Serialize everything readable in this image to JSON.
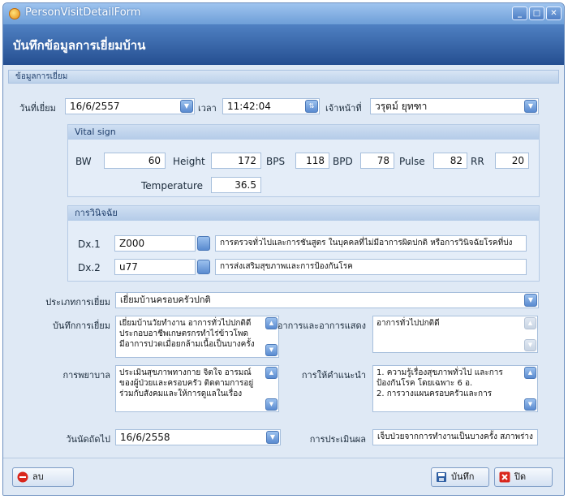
{
  "window": {
    "title": "PersonVisitDetailForm",
    "buttons": {
      "minimize": "_",
      "maximize": "□",
      "close": "✕"
    }
  },
  "header": {
    "title": "บันทึกข้อมูลการเยี่ยมบ้าน"
  },
  "section": {
    "title": "ข้อมูลการเยี่ยม"
  },
  "visit": {
    "date_label": "วันที่เยี่ยม",
    "date_value": "16/6/2557",
    "time_label": "เวลา",
    "time_value": "11:42:04",
    "officer_label": "เจ้าหน้าที่",
    "officer_value": "วรุตม์ ยุทฑา"
  },
  "vital": {
    "title": "Vital sign",
    "bw_label": "BW",
    "bw": "60",
    "height_label": "Height",
    "height": "172",
    "bps_label": "BPS",
    "bps": "118",
    "bpd_label": "BPD",
    "bpd": "78",
    "pulse_label": "Pulse",
    "pulse": "82",
    "rr_label": "RR",
    "rr": "20",
    "temp_label": "Temperature",
    "temp": "36.5"
  },
  "diagnosis": {
    "title": "การวินิจฉัย",
    "dx1_label": "Dx.1",
    "dx1_code": "Z000",
    "dx1_desc": "การตรวจทั่วไปและการชันสูตร ในบุคคลที่ไม่มีอาการผิดปกติ หรือการวินิจฉัยโรคที่บ่ง",
    "dx2_label": "Dx.2",
    "dx2_code": "u77",
    "dx2_desc": "การส่งเสริมสุขภาพและการป้องกันโรค"
  },
  "visit_type": {
    "label": "ประเภทการเยี่ยม",
    "value": "เยี่ยมบ้านครอบครัวปกติ"
  },
  "notes": {
    "record_label": "บันทึกการเยี่ยม",
    "record_lines": [
      "เยี่ยมบ้านวัยทำงาน อาการทั่วไปปกติดี",
      "ประกอบอาชีพเกษตรกรทำไร่ข้าวโพด",
      "มีอาการปวดเมื่อยกล้ามเนื้อเป็นบางครั้ง"
    ],
    "symptom_label": "อาการและอาการแสดง",
    "symptom_lines": [
      "อาการทั่วไปปกติดี"
    ],
    "nursing_label": "การพยาบาล",
    "nursing_lines": [
      "ประเมินสุขภาพทางกาย จิตใจ อารมณ์",
      "ของผู้ป่วยและครอบครัว ติดตามการอยู่",
      "ร่วมกับสังคมและให้การดูแลในเรื่อง"
    ],
    "advice_label": "การให้คำแนะนำ",
    "advice_lines": [
      "1. ความรู้เรื่องสุขภาพทั่วไป และการ",
      "ป้องกันโรค โดยเฉพาะ 6 อ.",
      "2. การวางแผนครอบครัวและการ"
    ]
  },
  "appointment": {
    "label": "วันนัดถัดไป",
    "value": "16/6/2558"
  },
  "evaluation": {
    "label": "การประเมินผล",
    "value": "เจ็บป่วยจากการทำงานเป็นบางครั้ง สภาพร่าง"
  },
  "footer": {
    "delete_label": "ลบ",
    "save_label": "บันทึก",
    "close_label": "ปิด"
  },
  "colors": {
    "header_bg": "#2f5fa3",
    "panel_bg": "#dfe9f5",
    "accent": "#5a8bd0"
  }
}
